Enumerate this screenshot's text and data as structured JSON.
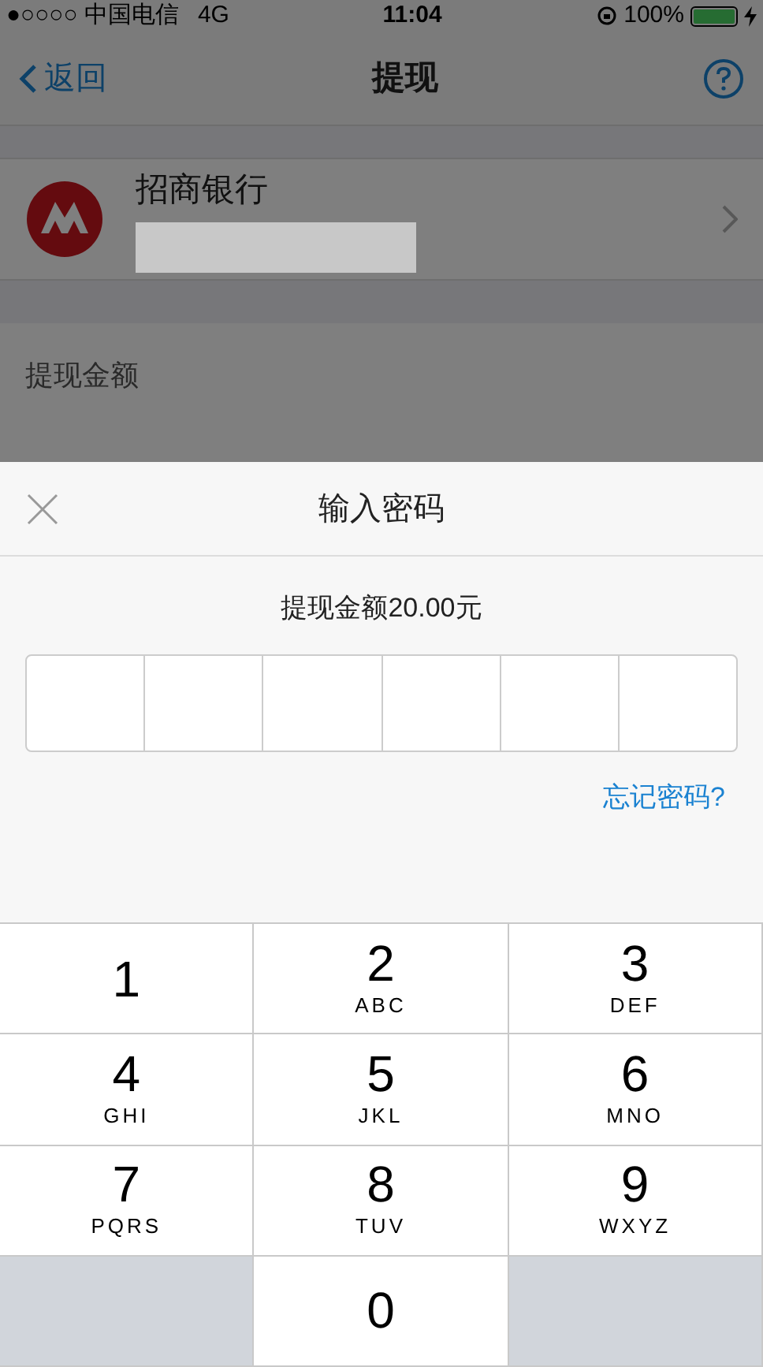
{
  "status_bar": {
    "carrier": "●○○○○ 中国电信",
    "network": "4G",
    "time": "11:04",
    "battery": "100%"
  },
  "nav": {
    "back": "返回",
    "title": "提现"
  },
  "bank": {
    "name": "招商银行"
  },
  "amount": {
    "label": "提现金额"
  },
  "sheet": {
    "title": "输入密码",
    "subtitle": "提现金额20.00元",
    "forgot": "忘记密码?",
    "password_boxes": [
      {
        "filled": false
      },
      {
        "filled": false
      },
      {
        "filled": false
      },
      {
        "filled": false
      },
      {
        "filled": false
      },
      {
        "filled": false
      }
    ]
  },
  "keypad": [
    {
      "kind": "digit",
      "digit": "1"
    },
    {
      "kind": "digit",
      "digit": "2",
      "letters": "ABC"
    },
    {
      "kind": "digit",
      "digit": "3",
      "letters": "DEF"
    },
    {
      "kind": "digit",
      "digit": "4",
      "letters": "GHI"
    },
    {
      "kind": "digit",
      "digit": "5",
      "letters": "JKL"
    },
    {
      "kind": "digit",
      "digit": "6",
      "letters": "MNO"
    },
    {
      "kind": "digit",
      "digit": "7",
      "letters": "PQRS"
    },
    {
      "kind": "digit",
      "digit": "8",
      "letters": "TUV"
    },
    {
      "kind": "digit",
      "digit": "9",
      "letters": "WXYZ"
    },
    {
      "kind": "blank"
    },
    {
      "kind": "digit",
      "digit": "0"
    },
    {
      "kind": "blank"
    }
  ]
}
